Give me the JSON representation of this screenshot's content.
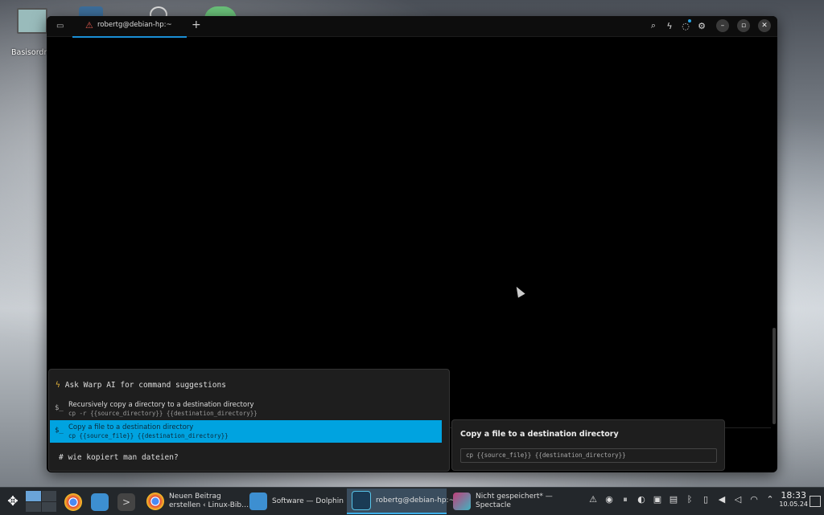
{
  "desktop": {
    "home_icon_label": "Basisordner"
  },
  "window": {
    "tab_title": "robertg@debian-hp:~",
    "new_tab_symbol": "+"
  },
  "ai_popup": {
    "header": "Ask Warp AI for command suggestions",
    "prompt_symbol": "$_",
    "items": [
      {
        "title": "Recursively copy a directory to a destination directory",
        "command": "cp -r {{source_directory}} {{destination_directory}}",
        "selected": false
      },
      {
        "title": "Copy a file to a destination directory",
        "command": "cp {{source_file}} {{destination_directory}}",
        "selected": true
      }
    ],
    "input": "# wie kopiert man dateien?"
  },
  "detail_panel": {
    "title": "Copy a file to a destination directory",
    "command": "cp {{source_file}} {{destination_directory}}"
  },
  "taskbar": {
    "tasks": [
      {
        "label": "Neuen Beitrag\nerstellen ‹ Linux-Bib…",
        "line1": "Neuen Beitrag",
        "line2": "erstellen ‹ Linux-Bib…",
        "icon": "chrome-icon"
      },
      {
        "label": "Software — Dolphin",
        "icon": "folder-icon"
      },
      {
        "label": "robertg@debian-hp:~",
        "icon": "warp-icon"
      },
      {
        "line1": "Nicht gespeichert* —",
        "line2": "Spectacle",
        "icon": "spectacle-icon"
      }
    ],
    "clock_time": "18:33",
    "clock_date": "10.05.24"
  },
  "colors": {
    "accent": "#00a3e0",
    "tab_underline": "#1a8fd6",
    "bolt": "#e8b73c",
    "warning": "#e05a4f"
  }
}
